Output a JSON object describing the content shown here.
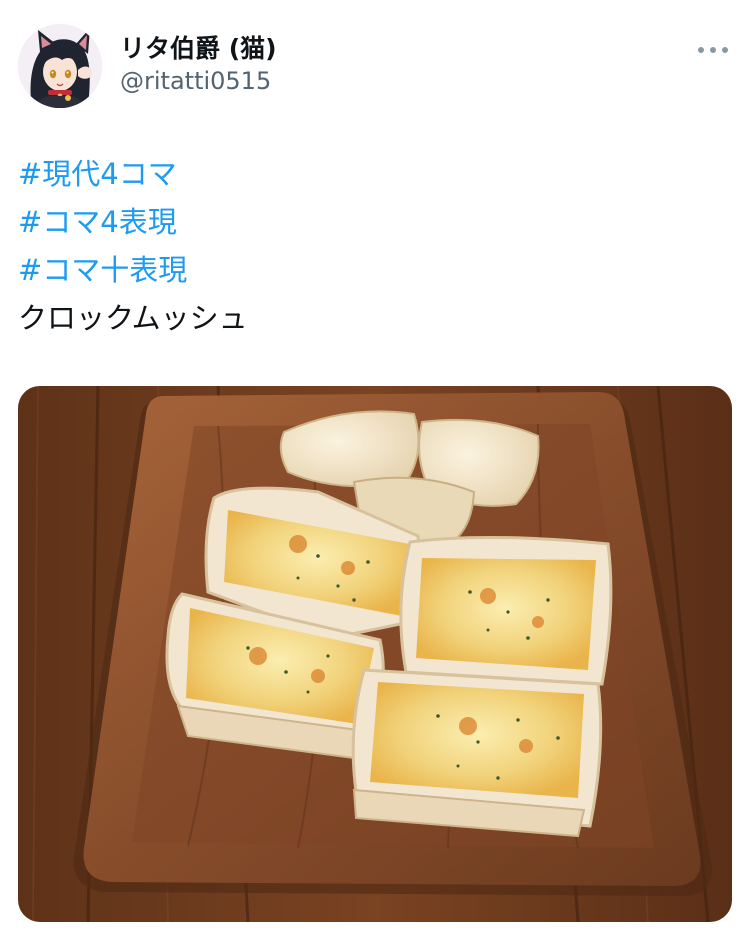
{
  "tweet": {
    "display_name": "リタ伯爵 (猫)",
    "handle": "@ritatti0515",
    "more_icon": "more-horizontal-icon",
    "lines": [
      {
        "type": "hashtag",
        "text": "#現代4コマ"
      },
      {
        "type": "hashtag",
        "text": "#コマ4表現"
      },
      {
        "type": "hashtag",
        "text": "#コマ十表現"
      },
      {
        "type": "text",
        "text": "クロックムッシュ"
      }
    ],
    "media": {
      "subject": "photo-croque-monsieur-on-wooden-plate"
    }
  },
  "colors": {
    "link": "#1d9bf0",
    "text": "#0f1419",
    "secondary": "#536471",
    "background": "#ffffff"
  }
}
